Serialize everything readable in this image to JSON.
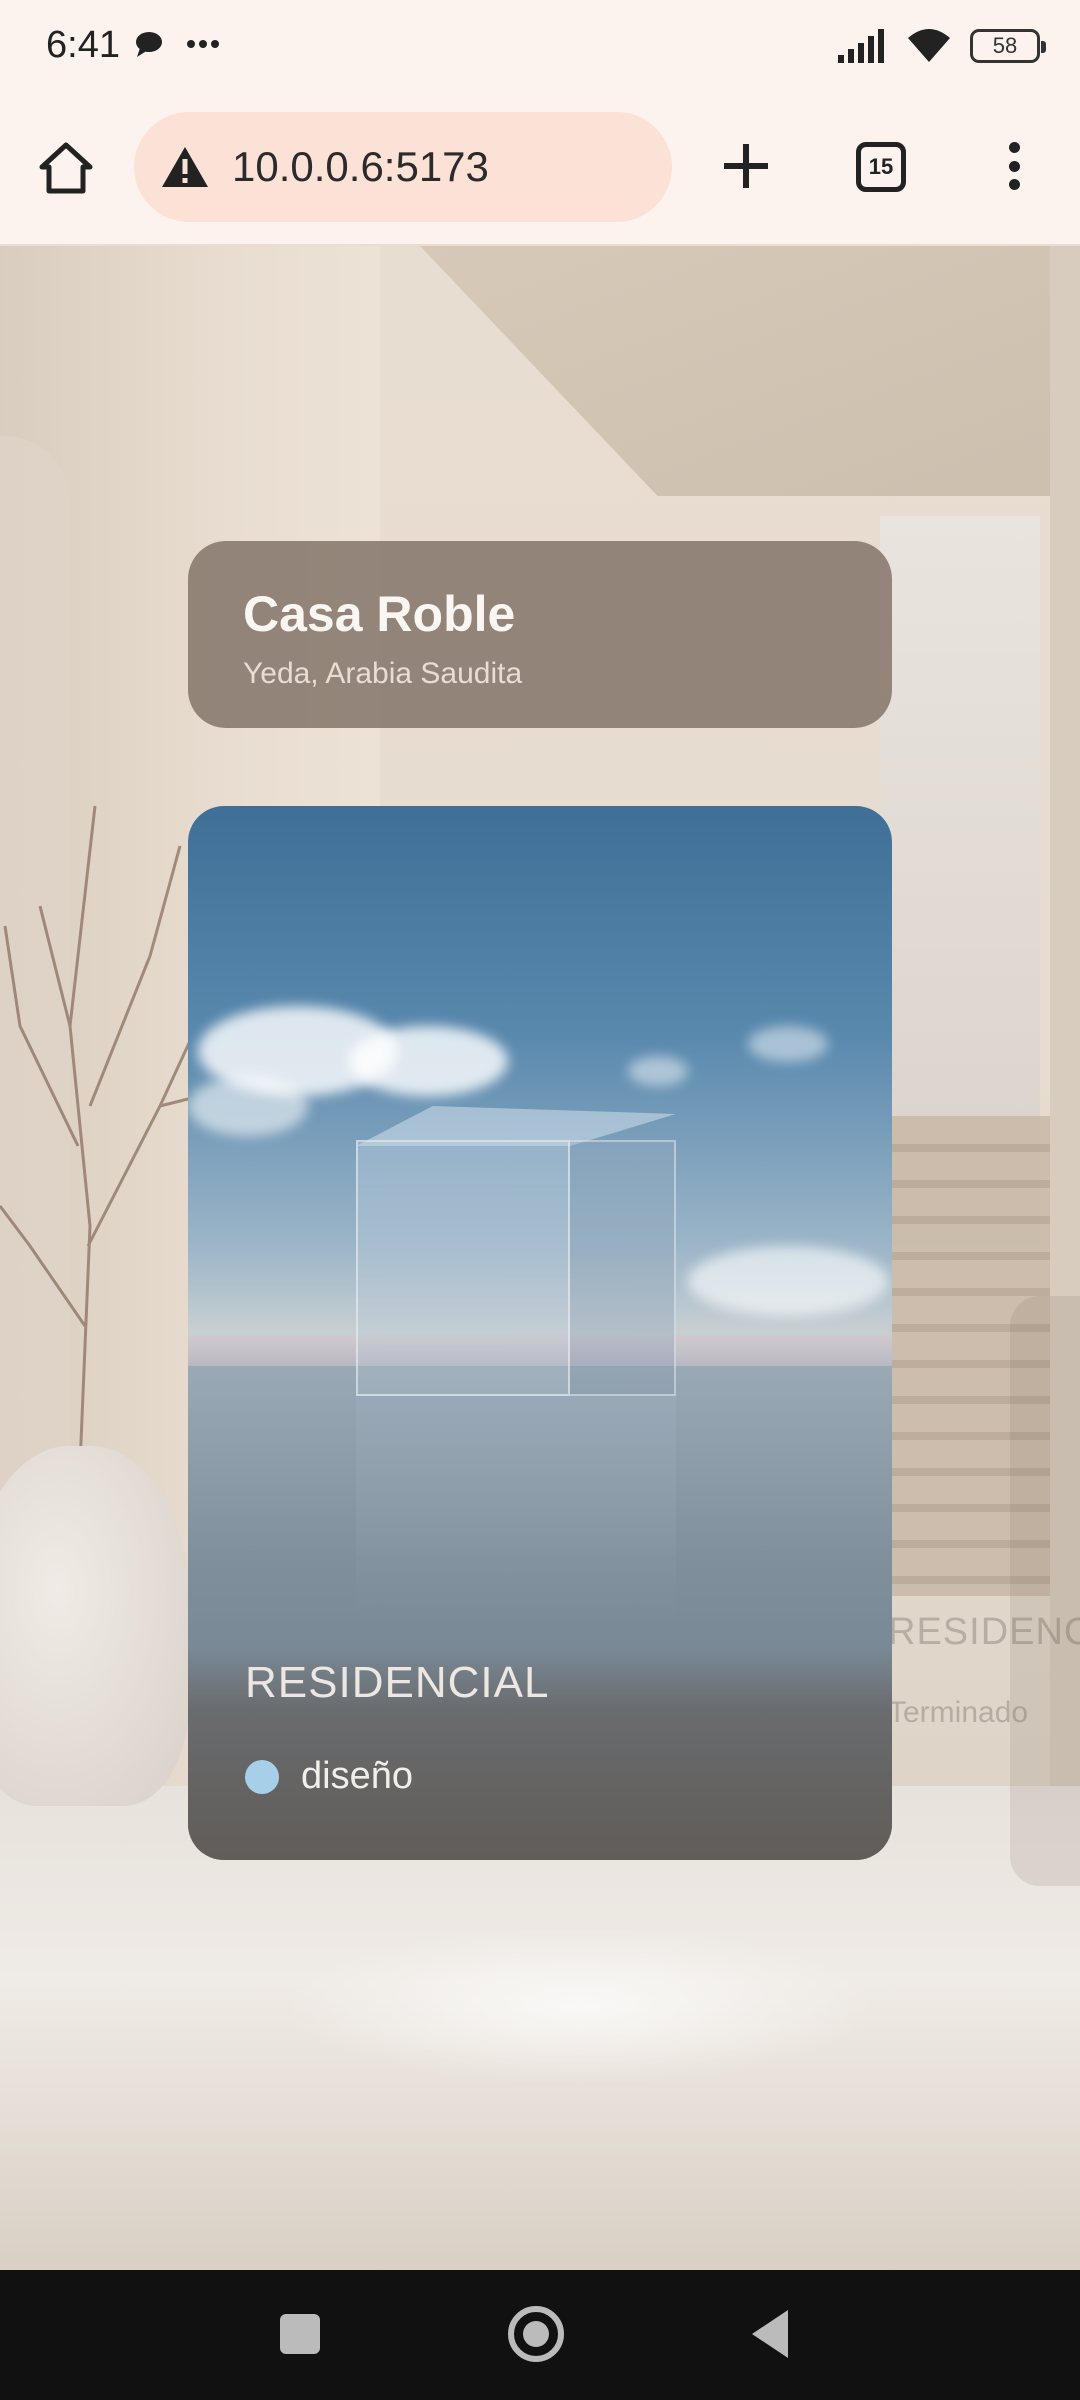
{
  "status_bar": {
    "time": "6:41",
    "notification_icon": "chat-bubble-icon",
    "overflow_icon": "more-dots-icon",
    "signal_icon": "signal-icon",
    "wifi_icon": "wifi-icon",
    "battery_level": "58"
  },
  "browser": {
    "home_icon": "home-icon",
    "security_icon": "warning-icon",
    "url": "10.0.0.6:5173",
    "new_tab_icon": "plus-icon",
    "tab_count": "15",
    "menu_icon": "vertical-dots-icon"
  },
  "project": {
    "name": "Casa Roble",
    "location": "Yeda, Arabia Saudita",
    "category": "RESIDENCIAL",
    "status": "diseño",
    "status_color": "#a7d0e8"
  },
  "background_card": {
    "category": "RESIDENCIAL",
    "status": "Terminado"
  },
  "nav_bar": {
    "recents_icon": "square-icon",
    "home_icon": "circle-home-icon",
    "back_icon": "back-triangle-icon"
  }
}
